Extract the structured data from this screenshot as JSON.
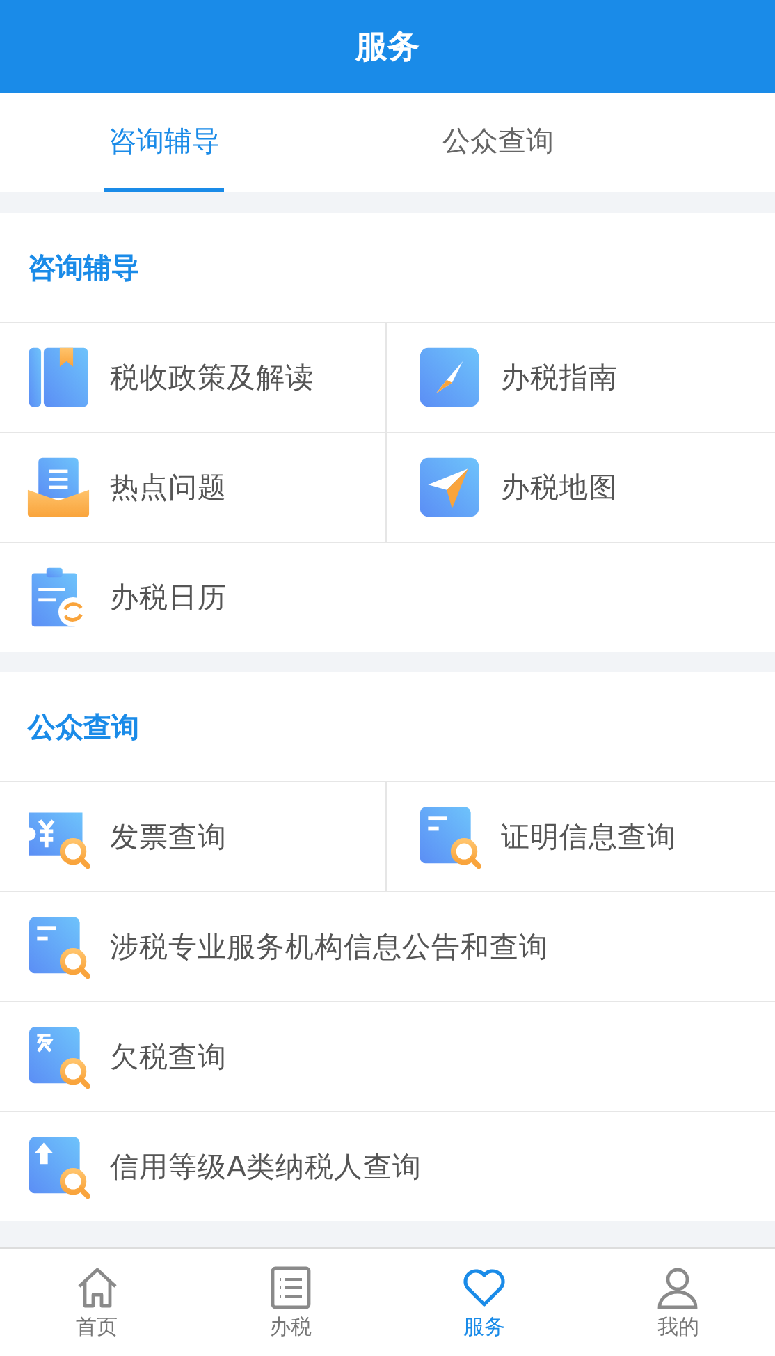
{
  "header": {
    "title": "服务"
  },
  "tabs": [
    {
      "label": "咨询辅导",
      "selected": true
    },
    {
      "label": "公众查询",
      "selected": false
    }
  ],
  "sections": [
    {
      "title": "咨询辅导",
      "rows": [
        [
          {
            "label": "税收政策及解读"
          },
          {
            "label": "办税指南"
          }
        ],
        [
          {
            "label": "热点问题"
          },
          {
            "label": "办税地图"
          }
        ],
        [
          {
            "label": "办税日历"
          }
        ]
      ]
    },
    {
      "title": "公众查询",
      "rows": [
        [
          {
            "label": "发票查询"
          },
          {
            "label": "证明信息查询"
          }
        ],
        [
          {
            "label": "涉税专业服务机构信息公告和查询"
          }
        ],
        [
          {
            "label": "欠税查询"
          }
        ],
        [
          {
            "label": "信用等级A类纳税人查询"
          }
        ]
      ]
    }
  ],
  "bottom_nav": [
    {
      "label": "首页",
      "selected": false
    },
    {
      "label": "办税",
      "selected": false
    },
    {
      "label": "服务",
      "selected": true
    },
    {
      "label": "我的",
      "selected": false
    }
  ]
}
